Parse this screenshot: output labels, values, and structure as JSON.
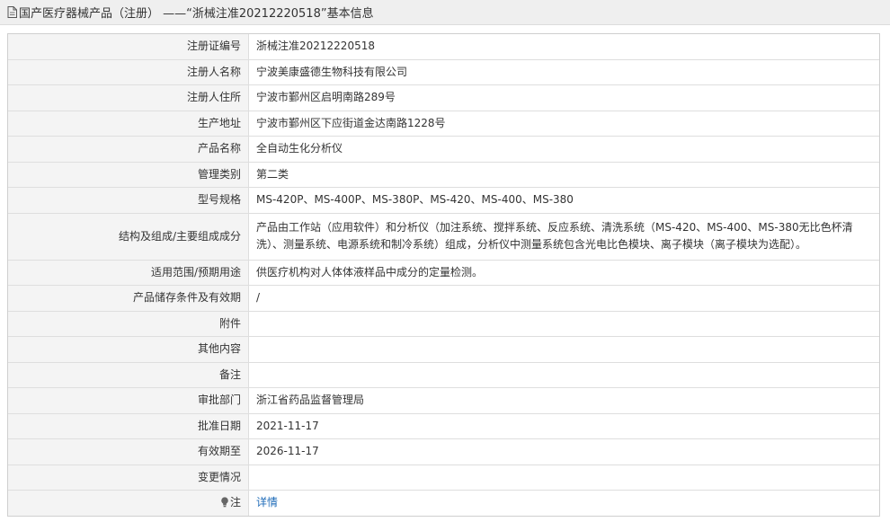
{
  "header": {
    "title": "国产医疗器械产品（注册） ——“浙械注准20212220518”基本信息",
    "icon": "document-icon"
  },
  "rows": [
    {
      "label": "注册证编号",
      "value": "浙械注准20212220518"
    },
    {
      "label": "注册人名称",
      "value": "宁波美康盛德生物科技有限公司"
    },
    {
      "label": "注册人住所",
      "value": "宁波市鄞州区启明南路289号"
    },
    {
      "label": "生产地址",
      "value": "宁波市鄞州区下应街道金达南路1228号"
    },
    {
      "label": "产品名称",
      "value": "全自动生化分析仪"
    },
    {
      "label": "管理类别",
      "value": "第二类"
    },
    {
      "label": "型号规格",
      "value": "MS-420P、MS-400P、MS-380P、MS-420、MS-400、MS-380"
    },
    {
      "label": "结构及组成/主要组成成分",
      "value": "产品由工作站（应用软件）和分析仪（加注系统、搅拌系统、反应系统、清洗系统（MS-420、MS-400、MS-380无比色杯清洗）、测量系统、电源系统和制冷系统）组成，分析仪中测量系统包含光电比色模块、离子模块（离子模块为选配）。"
    },
    {
      "label": "适用范围/预期用途",
      "value": "供医疗机构对人体体液样品中成分的定量检测。"
    },
    {
      "label": "产品储存条件及有效期",
      "value": "/"
    },
    {
      "label": "附件",
      "value": ""
    },
    {
      "label": "其他内容",
      "value": ""
    },
    {
      "label": "备注",
      "value": ""
    },
    {
      "label": "审批部门",
      "value": "浙江省药品监督管理局"
    },
    {
      "label": "批准日期",
      "value": "2021-11-17"
    },
    {
      "label": "有效期至",
      "value": "2026-11-17"
    },
    {
      "label": "变更情况",
      "value": ""
    },
    {
      "label": "注",
      "value": "详情",
      "icon": "lightbulb-icon"
    }
  ],
  "colors": {
    "link": "#1e6bb8",
    "label_bg": "#f4f4f4",
    "header_bg": "#efefef"
  }
}
